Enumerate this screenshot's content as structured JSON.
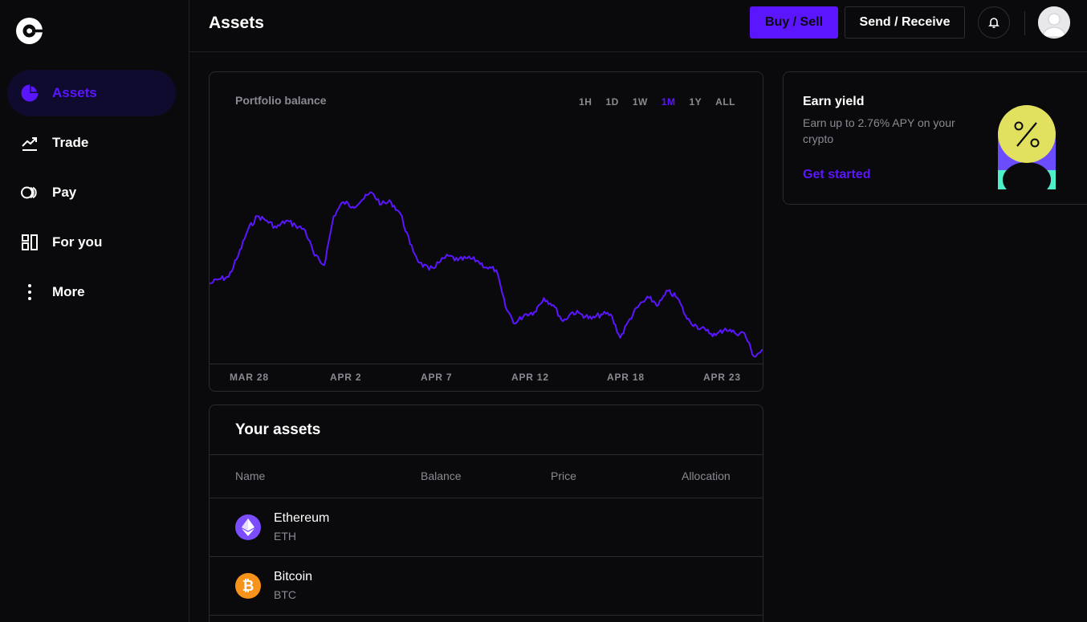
{
  "nav": {
    "items": [
      {
        "label": "Assets",
        "icon": "pie-chart-icon",
        "active": true
      },
      {
        "label": "Trade",
        "icon": "trend-up-icon",
        "active": false
      },
      {
        "label": "Pay",
        "icon": "pay-circles-icon",
        "active": false
      },
      {
        "label": "For you",
        "icon": "layout-blocks-icon",
        "active": false
      },
      {
        "label": "More",
        "icon": "more-vertical-icon",
        "active": false
      }
    ]
  },
  "header": {
    "title": "Assets",
    "buy_sell_label": "Buy / Sell",
    "send_receive_label": "Send / Receive"
  },
  "portfolio": {
    "title": "Portfolio balance",
    "ranges": [
      "1H",
      "1D",
      "1W",
      "1M",
      "1Y",
      "ALL"
    ],
    "selected_range": "1M"
  },
  "chart_data": {
    "type": "line",
    "title": "",
    "xlabel": "",
    "ylabel": "",
    "x_ticks": [
      "MAR 28",
      "APR 2",
      "APR 7",
      "APR 12",
      "APR 18",
      "APR 23"
    ],
    "series": [
      {
        "color": "#5b16ff",
        "values": [
          33,
          35,
          36,
          45,
          56,
          62,
          60,
          57,
          60,
          58,
          56,
          45,
          41,
          62,
          68,
          66,
          69,
          72,
          67,
          68,
          63,
          50,
          42,
          39,
          42,
          45,
          43,
          44,
          43,
          40,
          39,
          23,
          16,
          20,
          21,
          27,
          24,
          17,
          21,
          20,
          18,
          20,
          20,
          10,
          18,
          24,
          27,
          24,
          30,
          27,
          18,
          15,
          13,
          11,
          14,
          12,
          12,
          2,
          5
        ]
      }
    ],
    "grid": false,
    "legend": "none"
  },
  "assets": {
    "title": "Your assets",
    "columns": [
      "Name",
      "Balance",
      "Price",
      "Allocation"
    ],
    "rows": [
      {
        "name": "Ethereum",
        "ticker": "ETH",
        "icon": "ethereum-icon",
        "color": "#7b4dff"
      },
      {
        "name": "Bitcoin",
        "ticker": "BTC",
        "icon": "bitcoin-icon",
        "color": "#f7931a"
      }
    ]
  },
  "earn": {
    "title": "Earn yield",
    "description": "Earn up to 2.76% APY on your crypto",
    "cta": "Get started"
  },
  "colors": {
    "accent": "#5b16ff",
    "background": "#0a0a0c",
    "muted_text": "#8a8a93"
  }
}
